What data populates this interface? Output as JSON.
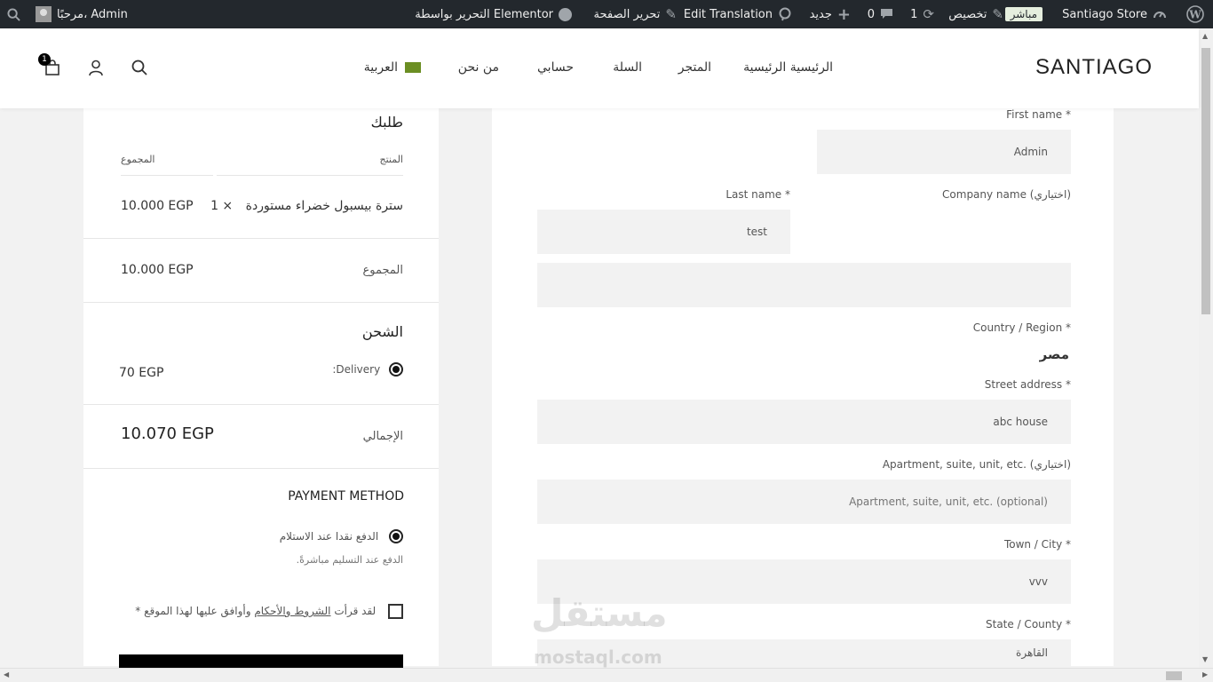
{
  "admin_bar": {
    "greeting": "مرحبًا، Admin",
    "site_name": "Santiago Store",
    "live_badge": "مباشر",
    "customize": "تخصيص",
    "updates_count": "1",
    "comments_count": "0",
    "new": "جديد",
    "edit_translation": "Edit Translation",
    "edit_page": "تحرير الصفحة",
    "edit_elementor": "التحرير بواسطة Elementor"
  },
  "header": {
    "logo": "SANTIAGO",
    "nav": [
      "الرئيسية الرئيسية",
      "المتجر",
      "السلة",
      "حسابي",
      "من نحن",
      "العربية"
    ],
    "cart_count": "1"
  },
  "order": {
    "title": "طلبك",
    "col_product": "المنتج",
    "col_total": "المجموع",
    "item_name": "سترة بيسبول خضراء مستوردة",
    "item_qty": "× 1",
    "item_total": "10.000 EGP",
    "subtotal_label": "المجموع",
    "subtotal_value": "10.000 EGP",
    "shipping_title": "الشحن",
    "shipping_method": "Delivery:",
    "shipping_value": "70 EGP",
    "total_label": "الإجمالي",
    "total_value": "10.070 EGP",
    "payment_title": "PAYMENT METHOD",
    "payment_option": "الدفع نقدا عند الاستلام",
    "payment_desc": "الدفع عند التسليم مباشرةً.",
    "terms_prefix": "لقد قرأت",
    "terms_link": "الشروط والأحكام",
    "terms_suffix": "وأوافق عليها لهذا الموقع *"
  },
  "billing": {
    "first_name_label": "First name *",
    "first_name_value": "Admin",
    "last_name_label": "Last name *",
    "last_name_value": "test",
    "company_label": "Company name (اختياري)",
    "company_value": "",
    "country_label": "Country / Region *",
    "country_value": "مصر",
    "street_label": "Street address *",
    "street_value": "abc house",
    "apartment_label": "Apartment, suite, unit, etc. (اختياري)",
    "apartment_placeholder": "Apartment, suite, unit, etc. (optional)",
    "city_label": "Town / City *",
    "city_value": "vvv",
    "state_label": "State / County *",
    "state_value": "القاهرة"
  },
  "watermark": {
    "arabic": "مستقل",
    "latin": "mostaql.com"
  }
}
